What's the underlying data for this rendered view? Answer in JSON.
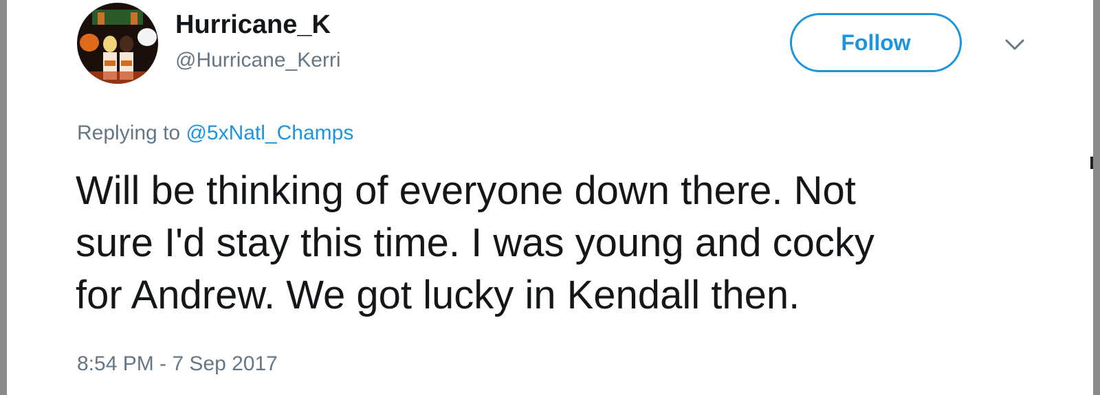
{
  "user": {
    "display_name": "Hurricane_K",
    "handle": "@Hurricane_Kerri"
  },
  "actions": {
    "follow_label": "Follow",
    "more_icon": "chevron-down-icon"
  },
  "reply": {
    "prefix": "Replying to",
    "mention": "@5xNatl_Champs"
  },
  "tweet": {
    "lines": [
      "Will be thinking of everyone down there. Not",
      "sure I'd stay this time. I was young and cocky",
      "for Andrew. We got lucky in Kendall then."
    ]
  },
  "timestamp": "8:54 PM - 7 Sep 2017",
  "colors": {
    "link": "#1b95e0",
    "text": "#14171a",
    "secondary": "#657786"
  }
}
